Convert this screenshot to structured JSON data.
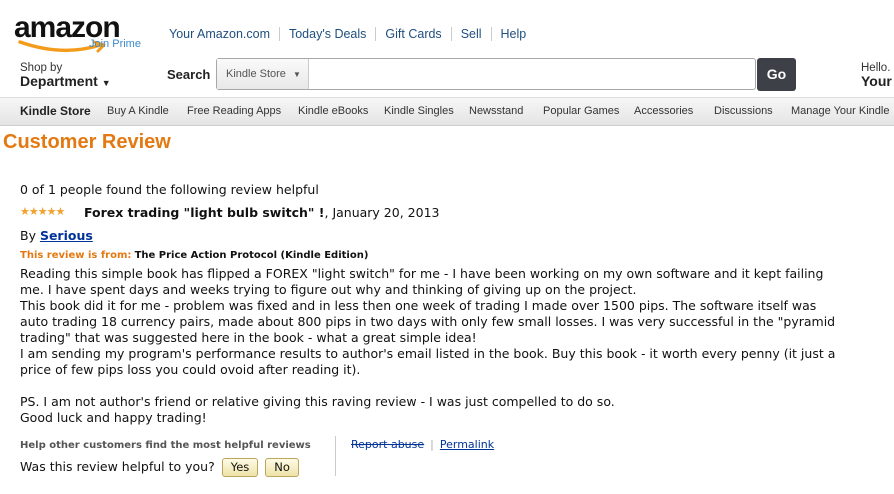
{
  "header": {
    "logo_text": "amazon",
    "join_prime": "Join Prime",
    "nav_links": [
      "Your Amazon.com",
      "Today's Deals",
      "Gift Cards",
      "Sell",
      "Help"
    ],
    "shop_by_line1": "Shop by",
    "shop_by_line2": "Department",
    "search_label": "Search",
    "search_category": "Kindle Store",
    "search_value": "",
    "go_label": "Go",
    "hello_line1": "Hello.",
    "hello_line2": "Your"
  },
  "subnav": [
    "Kindle Store",
    "Buy A Kindle",
    "Free Reading Apps",
    "Kindle eBooks",
    "Kindle Singles",
    "Newsstand",
    "Popular Games",
    "Accessories",
    "Discussions",
    "Manage Your Kindle"
  ],
  "page_title": "Customer Review",
  "review": {
    "helpful_count": "0 of 1 people found the following review helpful",
    "stars": "★★★★★",
    "rating_value": 5,
    "title": "Forex trading \"light bulb switch\" !",
    "date": ", January 20, 2013",
    "by_label": "By ",
    "author": "Serious",
    "from_label": "This review is from:",
    "product": "The Price Action Protocol (Kindle Edition)",
    "body": "Reading this simple book has flipped a FOREX \"light switch\" for me - I have been working on my own software and it kept failing\nme. I have spent days and weeks trying to figure out why and thinking of giving up on the project.\nThis book did it for me - problem was fixed and in less then one week of trading I made over 1500 pips. The software itself was\nauto trading 18 currency pairs, made about 800 pips in two days with only few small losses. I was very successful in the \"pyramid\ntrading\" that was suggested here in the book - what a great simple idea!\nI am sending my program's performance results to author's email listed in the book. Buy this book - it worth every penny (it just a\nprice of few pips loss you could ovoid after reading it).\n\nPS. I am not author's friend or relative giving this raving review - I was just compelled to do so.\nGood luck and happy trading!"
  },
  "footer": {
    "help_other": "Help other customers find the most helpful reviews",
    "helpful_question": "Was this review helpful to you?",
    "yes": "Yes",
    "no": "No",
    "report_abuse": "Report abuse",
    "permalink": "Permalink"
  },
  "colors": {
    "title_orange": "#e47911",
    "link_blue": "#003399",
    "star_color": "#f1a12d"
  }
}
